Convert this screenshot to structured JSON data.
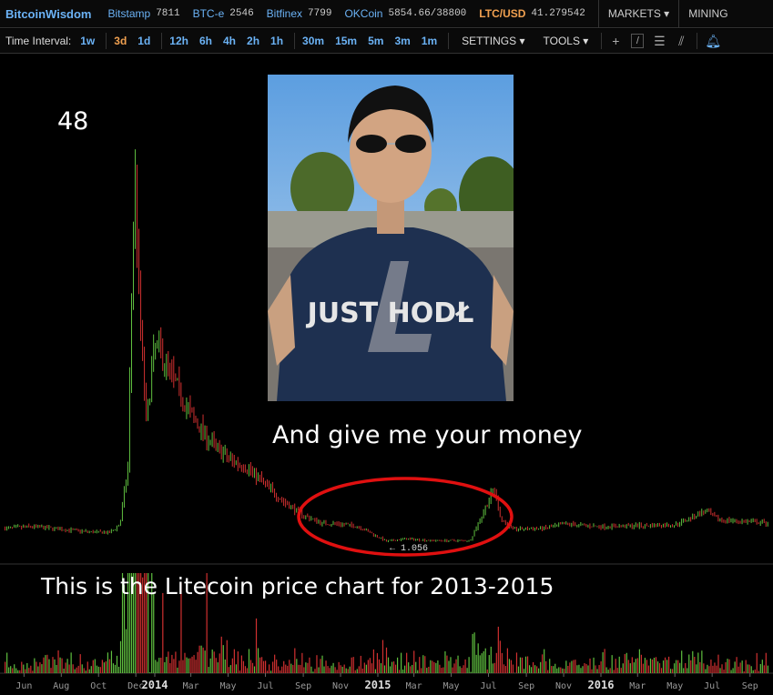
{
  "header": {
    "brand": "BitcoinWisdom",
    "markets": [
      {
        "name": "Bitstamp",
        "value": "7811"
      },
      {
        "name": "BTC-e",
        "value": "2546"
      },
      {
        "name": "Bitfinex",
        "value": "7799"
      },
      {
        "name": "OKCoin",
        "value": "5854.66/38800"
      }
    ],
    "pair": "LTC/USD",
    "pair_value": "41.279542",
    "menu_markets": "MARKETS ▾",
    "menu_mining": "MINING"
  },
  "toolbar": {
    "label": "Time Interval:",
    "intervals": [
      "1w",
      "3d",
      "1d",
      "12h",
      "6h",
      "4h",
      "2h",
      "1h",
      "30m",
      "15m",
      "5m",
      "3m",
      "1m"
    ],
    "active": "3d",
    "settings": "SETTINGS ▾",
    "tools": "TOOLS ▾",
    "icons": [
      "crosshair-icon",
      "line-icon",
      "fib-icon",
      "pitchfork-icon",
      "bell-icon"
    ]
  },
  "overlay": {
    "peak_label": "48",
    "caption_top": "And give me your money",
    "caption_bottom": "This is the Litecoin price chart for 2013-2015",
    "shirt_text": "JUST HODŁ",
    "low_marker": "← 1.056",
    "circle_color": "#e01010"
  },
  "chart_data": {
    "type": "candlestick",
    "interval": "3d",
    "up_color": "#5fbf3f",
    "down_color": "#d03030",
    "x_ticks": [
      "Jun",
      "Aug",
      "Oct",
      "Dec",
      "2014",
      "Mar",
      "May",
      "Jul",
      "Sep",
      "Nov",
      "2015",
      "Mar",
      "May",
      "Jul",
      "Sep",
      "Nov",
      "2016",
      "Mar",
      "May",
      "Jul",
      "Sep"
    ],
    "approx_price_path": [
      [
        "2013-05-01",
        3.0
      ],
      [
        "2013-06-15",
        3.2
      ],
      [
        "2013-08-01",
        2.9
      ],
      [
        "2013-09-15",
        2.6
      ],
      [
        "2013-10-20",
        2.5
      ],
      [
        "2013-11-05",
        3.5
      ],
      [
        "2013-11-18",
        10
      ],
      [
        "2013-11-29",
        45
      ],
      [
        "2013-12-06",
        30
      ],
      [
        "2013-12-18",
        15
      ],
      [
        "2014-01-01",
        24
      ],
      [
        "2014-01-12",
        23
      ],
      [
        "2014-02-01",
        20
      ],
      [
        "2014-03-01",
        16
      ],
      [
        "2014-04-01",
        13
      ],
      [
        "2014-05-01",
        11
      ],
      [
        "2014-06-01",
        10
      ],
      [
        "2014-07-01",
        8
      ],
      [
        "2014-08-01",
        6
      ],
      [
        "2014-09-01",
        4.5
      ],
      [
        "2014-10-01",
        3.6
      ],
      [
        "2014-11-01",
        3.5
      ],
      [
        "2014-12-01",
        3.2
      ],
      [
        "2015-01-15",
        1.5
      ],
      [
        "2015-02-15",
        1.8
      ],
      [
        "2015-04-01",
        1.6
      ],
      [
        "2015-06-01",
        1.6
      ],
      [
        "2015-07-10",
        7.5
      ],
      [
        "2015-07-22",
        4
      ],
      [
        "2015-08-10",
        2.9
      ],
      [
        "2015-10-01",
        3.0
      ],
      [
        "2015-11-05",
        3.5
      ],
      [
        "2016-01-01",
        3.2
      ],
      [
        "2016-05-01",
        3.4
      ],
      [
        "2016-06-20",
        5
      ],
      [
        "2016-07-10",
        4
      ],
      [
        "2016-10-01",
        3.6
      ]
    ]
  }
}
